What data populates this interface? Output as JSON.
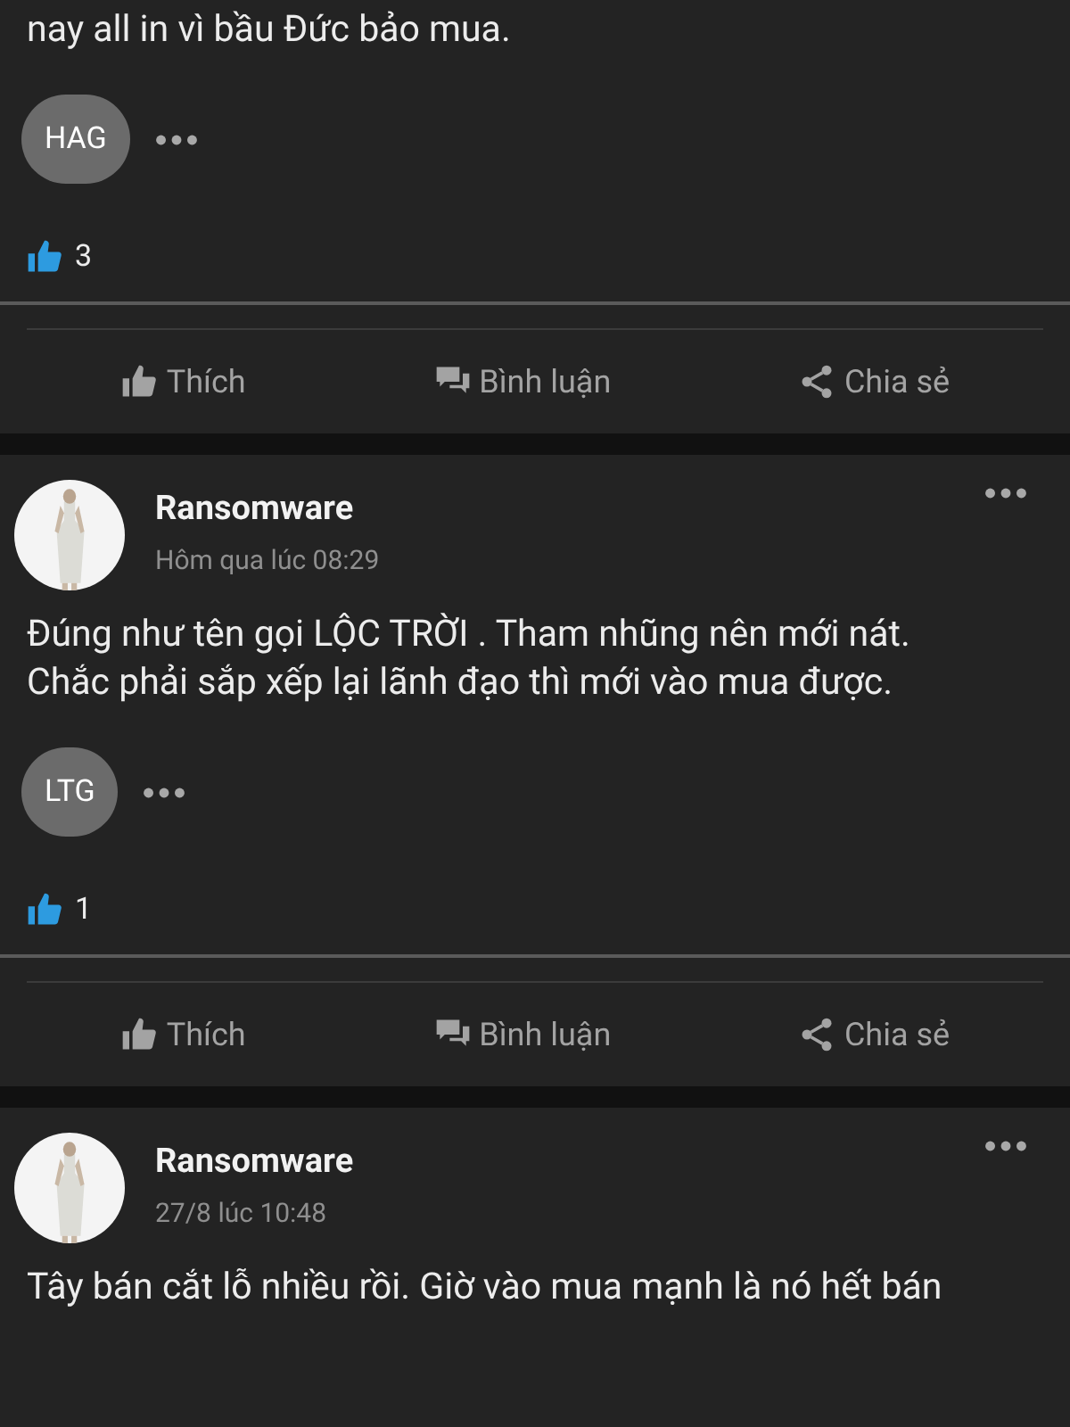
{
  "posts": [
    {
      "text": "nay all in vì bầu Đức bảo mua.",
      "tag": "HAG",
      "likes": "3",
      "actions": [
        "Thích",
        "Bình luận",
        "Chia sẻ"
      ]
    },
    {
      "author": "Ransomware",
      "time": "Hôm qua lúc 08:29",
      "text": "Đúng như tên gọi LỘC TRỜI . Tham nhũng nên mới nát. Chắc phải sắp xếp lại lãnh đạo thì mới vào mua được.",
      "tag": "LTG",
      "likes": "1",
      "actions": [
        "Thích",
        "Bình luận",
        "Chia sẻ"
      ]
    },
    {
      "author": "Ransomware",
      "time": "27/8 lúc 10:48",
      "text": "Tây bán cắt lỗ nhiều rồi. Giờ vào mua mạnh là nó hết bán"
    }
  ]
}
